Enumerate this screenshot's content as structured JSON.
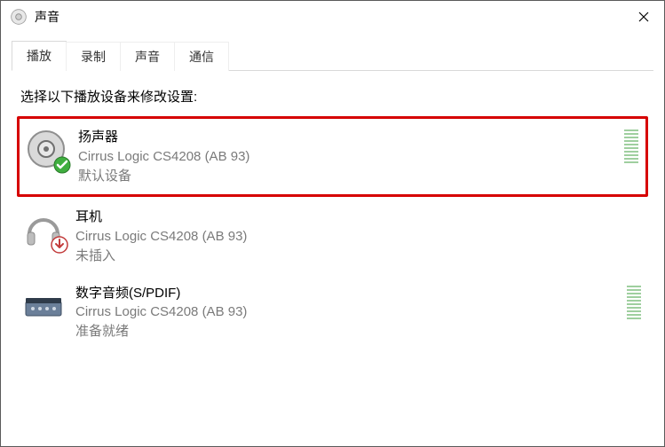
{
  "window": {
    "title": "声音"
  },
  "tabs": [
    {
      "id": "playback",
      "label": "播放",
      "active": true
    },
    {
      "id": "record",
      "label": "录制",
      "active": false
    },
    {
      "id": "sound",
      "label": "声音",
      "active": false
    },
    {
      "id": "comm",
      "label": "通信",
      "active": false
    }
  ],
  "instruction": "选择以下播放设备来修改设置:",
  "devices": [
    {
      "id": "speaker",
      "name": "扬声器",
      "driver": "Cirrus Logic CS4208 (AB 93)",
      "status": "默认设备",
      "icon": "speaker-icon",
      "badge": "check",
      "highlighted": true,
      "show_level": true
    },
    {
      "id": "headphone",
      "name": "耳机",
      "driver": "Cirrus Logic CS4208 (AB 93)",
      "status": "未插入",
      "icon": "headphone-icon",
      "badge": "down",
      "highlighted": false,
      "show_level": false
    },
    {
      "id": "spdif",
      "name": "数字音频(S/PDIF)",
      "driver": "Cirrus Logic CS4208 (AB 93)",
      "status": "准备就绪",
      "icon": "spdif-icon",
      "badge": null,
      "highlighted": false,
      "show_level": true
    }
  ]
}
